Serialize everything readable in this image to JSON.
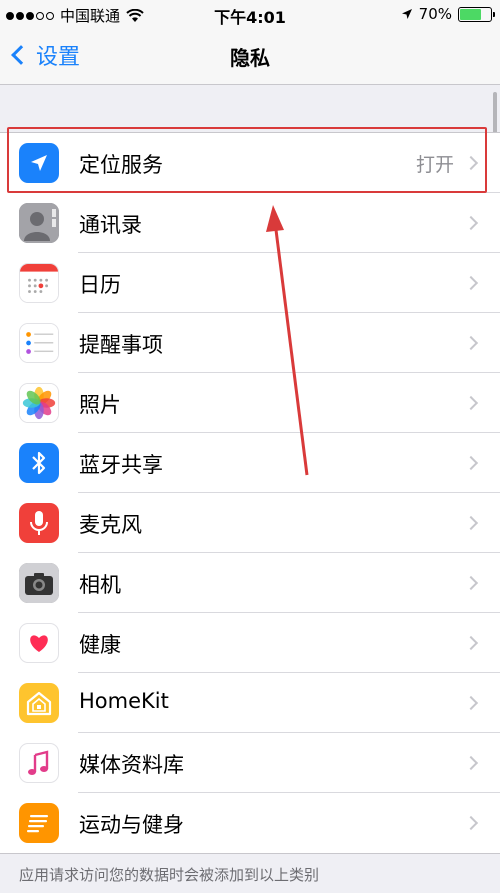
{
  "status": {
    "carrier": "中国联通",
    "time": "下午4:01",
    "battery": "70%",
    "battery_level": 0.7
  },
  "nav": {
    "back_label": "设置",
    "title": "隐私"
  },
  "rows": [
    {
      "label": "定位服务",
      "value": "打开",
      "icon": "location-arrow-icon",
      "color": "#1a82fb"
    },
    {
      "label": "通讯录",
      "value": "",
      "icon": "contacts-icon",
      "color": "#8e8e93"
    },
    {
      "label": "日历",
      "value": "",
      "icon": "calendar-icon",
      "color": "#ffffff"
    },
    {
      "label": "提醒事项",
      "value": "",
      "icon": "reminders-icon",
      "color": "#ffffff"
    },
    {
      "label": "照片",
      "value": "",
      "icon": "photos-icon",
      "color": "#ffffff"
    },
    {
      "label": "蓝牙共享",
      "value": "",
      "icon": "bluetooth-icon",
      "color": "#1a82fb"
    },
    {
      "label": "麦克风",
      "value": "",
      "icon": "microphone-icon",
      "color": "#f0403a"
    },
    {
      "label": "相机",
      "value": "",
      "icon": "camera-icon",
      "color": "#8e8e93"
    },
    {
      "label": "健康",
      "value": "",
      "icon": "heart-icon",
      "color": "#ffffff"
    },
    {
      "label": "HomeKit",
      "value": "",
      "icon": "home-icon",
      "color": "#fec42e"
    },
    {
      "label": "媒体资料库",
      "value": "",
      "icon": "music-icon",
      "color": "#ffffff"
    },
    {
      "label": "运动与健身",
      "value": "",
      "icon": "motion-icon",
      "color": "#ff9500"
    }
  ],
  "footer": "应用请求访问您的数据时会被添加到以上类别"
}
